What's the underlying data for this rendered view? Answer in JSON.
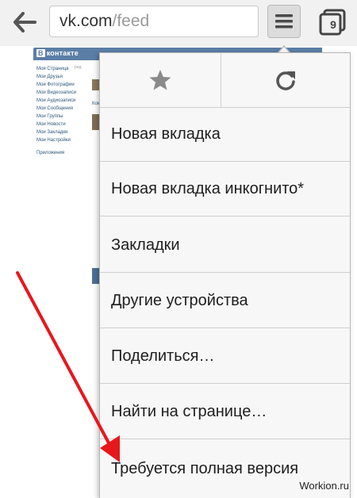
{
  "browser": {
    "url_host": "vk.com",
    "url_path": "/feed",
    "tabs_count": "9"
  },
  "vk": {
    "logo_b": "В",
    "logo_text": "контакте",
    "edit": "ред.",
    "menu": [
      "Моя Страница",
      "Мои Друзья",
      "Мои Фотографии",
      "Мои Видеозаписи",
      "Мои Аудиозаписи",
      "Мои Сообщения",
      "Мои Группы",
      "Мои Новости",
      "Мои Закладки",
      "Мои Настройки"
    ],
    "apps": "Приложения",
    "snippet": "Ком"
  },
  "dropdown": {
    "icons": [
      "star-icon",
      "reload-icon"
    ],
    "items": [
      "Новая вкладка",
      "Новая вкладка инкогнито*",
      "Закладки",
      "Другие устройства",
      "Поделиться…",
      "Найти на странице…",
      "Требуется полная версия"
    ]
  },
  "colors": {
    "arrow": "#e8171c",
    "vk_blue": "#5b7ea6"
  },
  "watermark": "Workion.ru"
}
